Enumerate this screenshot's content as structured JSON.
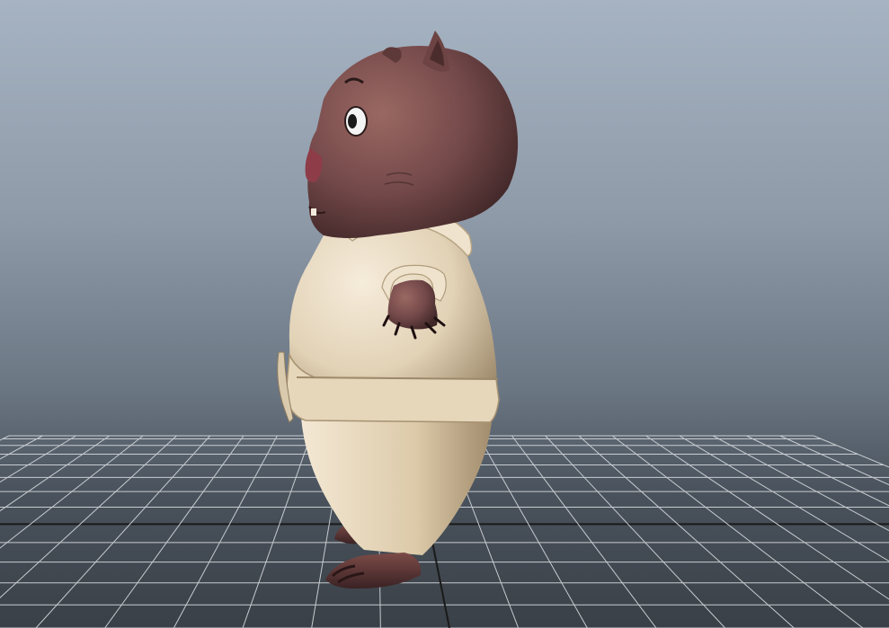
{
  "viewport": {
    "background_top": "#a6b3c2",
    "background_bottom": "#3a4047",
    "grid_line_color": "#c8ccd0",
    "grid_axis_color": "#1a1a1a"
  },
  "character": {
    "fur_color": "#7a4e4a",
    "fur_shadow": "#4e2f2d",
    "suit_color": "#e8d9c0",
    "suit_shadow": "#a89474",
    "nose_color": "#8e3c48"
  }
}
